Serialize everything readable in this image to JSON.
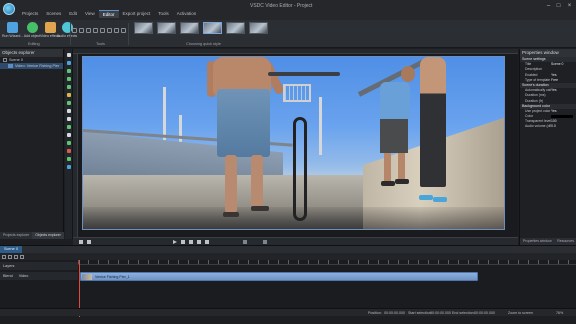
{
  "window": {
    "title": "VSDC Video Editor - Project"
  },
  "menu": {
    "items": [
      "Projects",
      "Scenes",
      "Edit",
      "View",
      "Editor",
      "Export project",
      "Tools",
      "Activation"
    ],
    "active_index": 4
  },
  "ribbon": {
    "buttons": [
      {
        "label": "Run Wizard...",
        "icon": "wand-icon",
        "color": "#4fa3e0"
      },
      {
        "label": "Add object",
        "icon": "add-object-icon",
        "color": "#47c06a"
      },
      {
        "label": "Video effects",
        "icon": "video-effects-icon",
        "color": "#e0a64f"
      },
      {
        "label": "Audio effects",
        "icon": "audio-effects-icon",
        "color": "#4fc7d6"
      }
    ],
    "group_editing": "Editing",
    "group_tools": "Tools",
    "group_quick_style": "Choosing quick style",
    "quick_styles_count": 6
  },
  "left_panel": {
    "title": "Objects explorer",
    "tree": [
      {
        "label": "Scene 0",
        "selected": false
      },
      {
        "label": "Video: Venice Fishing Pier",
        "selected": true
      }
    ],
    "footer_tabs": [
      "Projects explorer",
      "Objects explorer"
    ],
    "footer_active": 1
  },
  "right_panel": {
    "title": "Properties window",
    "sections": [
      {
        "header": "Scene settings",
        "rows": [
          {
            "key": "Title",
            "value": "Scene 0"
          },
          {
            "key": "Description",
            "value": ""
          },
          {
            "key": "Enabled",
            "value": "Yes"
          },
          {
            "key": "Type of template",
            "value": "Free"
          }
        ]
      },
      {
        "header": "Scene's duration",
        "rows": [
          {
            "key": "Automatically calc",
            "value": "Yes"
          },
          {
            "key": "Duration (ms)",
            "value": ""
          },
          {
            "key": "Duration (fr)",
            "value": ""
          }
        ]
      },
      {
        "header": "Background color",
        "rows": [
          {
            "key": "Use project color",
            "value": "Yes"
          },
          {
            "key": "Color",
            "value": ""
          },
          {
            "key": "Transparent level",
            "value": "100"
          },
          {
            "key": "Audio volume (dB)",
            "value": "0.0"
          }
        ]
      }
    ],
    "footer_tabs": [
      "Properties window",
      "Resources"
    ]
  },
  "stage": {
    "zoom": "76%"
  },
  "timeline": {
    "tab": "Scene 0",
    "tracks": [
      {
        "name": "Layers",
        "blend": ""
      },
      {
        "name": "Video",
        "blend": "Blend"
      }
    ],
    "clip_label": "Venice Fishing Pier_1"
  },
  "status": {
    "position_label": "Position:",
    "position": "00:00:00.000",
    "start_label": "Start selection:",
    "start": "00:00:00.000",
    "end_label": "End selection:",
    "end": "00:00:00.000",
    "zoom_label": "Zoom to screen",
    "zoom": "76%"
  },
  "colors": {
    "accent": "#2e5d8a",
    "clip": "#8db0dd",
    "playhead": "#e04b3d"
  }
}
